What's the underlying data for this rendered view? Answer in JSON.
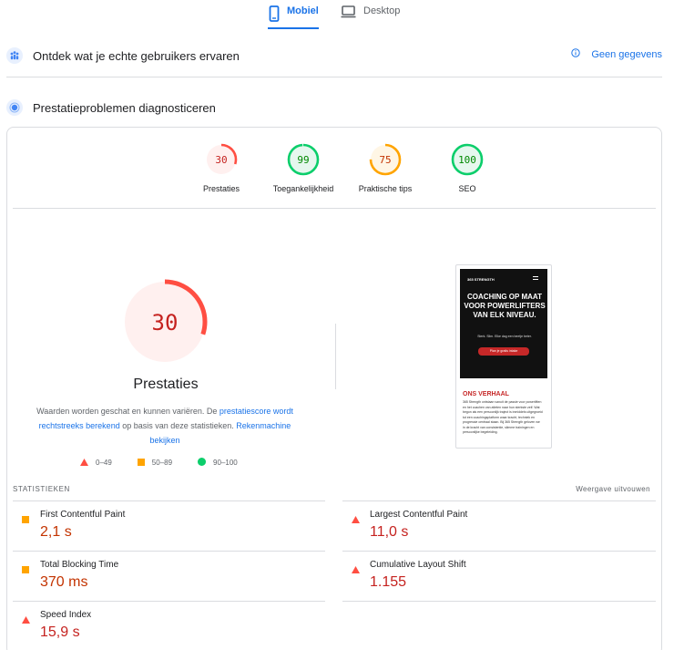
{
  "tabs": {
    "mobile": "Mobiel",
    "desktop": "Desktop"
  },
  "sections": {
    "field": {
      "title": "Ontdek wat je echte gebruikers ervaren",
      "no_data": "Geen gegevens"
    },
    "lab": {
      "title": "Prestatieproblemen diagnosticeren"
    }
  },
  "categories": [
    {
      "label": "Prestaties",
      "score": "30",
      "score_fraction": 0.3,
      "color": "#ff4e42",
      "fill": "#fff0ef",
      "text_color": "#c5221f"
    },
    {
      "label": "Toegankelijkheid",
      "score": "99",
      "score_fraction": 0.99,
      "color": "#0cce6b",
      "fill": "#e6f7ee",
      "text_color": "#008800"
    },
    {
      "label": "Praktische tips",
      "score": "75",
      "score_fraction": 0.75,
      "color": "#ffa400",
      "fill": "#fff6e5",
      "text_color": "#c33300"
    },
    {
      "label": "SEO",
      "score": "100",
      "score_fraction": 1.0,
      "color": "#0cce6b",
      "fill": "#e6f7ee",
      "text_color": "#008800"
    }
  ],
  "main_score": {
    "score": "30",
    "score_fraction": 0.3,
    "label": "Prestaties"
  },
  "description": {
    "part1": "Waarden worden geschat en kunnen variëren. De ",
    "link1": "prestatiescore wordt rechtstreeks berekend",
    "part2": " op basis van deze statistieken. ",
    "link2": "Rekenmachine bekijken"
  },
  "legend": [
    {
      "range": "0–49",
      "shape": "triangle",
      "color": "#ff4e42"
    },
    {
      "range": "50–89",
      "shape": "square",
      "color": "#ffa400"
    },
    {
      "range": "90–100",
      "shape": "circle",
      "color": "#0cce6b"
    }
  ],
  "preview": {
    "logo": "365 STRENGTH",
    "headline": "COACHING OP MAAT VOOR POWERLIFTERS VAN ELK NIVEAU.",
    "tagline": "Sterk. Slim. Elke dag een beetje beter.",
    "button": "Plan je gratis intake",
    "section_title": "ONS VERHAAL",
    "body": "365 Strength ontstaan vanuit de passie voor powerliften en het coachen van atleten naar hun sterkste zelf. Wat begon als een persoonlijk traject is inmiddels uitgegroeid tot een coachingsplatform waar kracht, techniek en progressie centraal staan. Bij 365 Strength geloven we in de kracht van consistentie, slimme trainingen en persoonlijke begeleiding."
  },
  "stats": {
    "heading": "STATISTIEKEN",
    "expand": "Weergave uitvouwen",
    "metrics": [
      {
        "title": "First Contentful Paint",
        "value": "2,1 s",
        "rating": "average"
      },
      {
        "title": "Largest Contentful Paint",
        "value": "11,0 s",
        "rating": "fail"
      },
      {
        "title": "Total Blocking Time",
        "value": "370 ms",
        "rating": "average"
      },
      {
        "title": "Cumulative Layout Shift",
        "value": "1.155",
        "rating": "fail"
      },
      {
        "title": "Speed Index",
        "value": "15,9 s",
        "rating": "fail"
      }
    ]
  },
  "colors": {
    "accent": "#1a73e8",
    "fail": "#ff4e42",
    "average": "#ffa400",
    "pass": "#0cce6b"
  }
}
